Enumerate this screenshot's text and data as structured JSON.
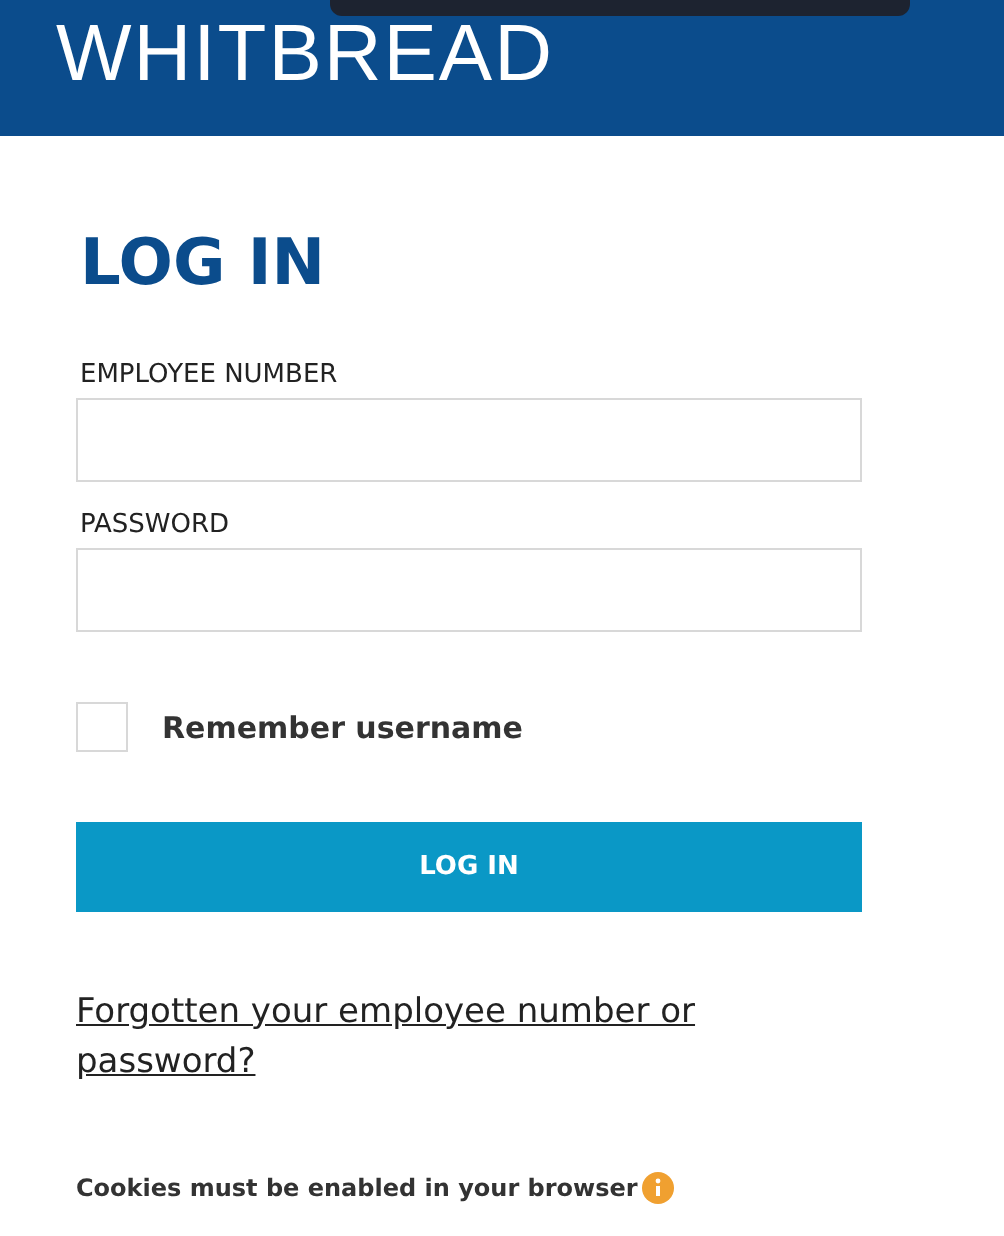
{
  "header": {
    "logo": "WHITBREAD"
  },
  "form": {
    "title": "LOG IN",
    "fields": [
      {
        "label": "EMPLOYEE NUMBER"
      },
      {
        "label": "PASSWORD"
      }
    ],
    "remember": {
      "label": "Remember username",
      "checked": false
    },
    "submit": "LOG IN",
    "forgot_link": "Forgotten your employee number or password?",
    "cookie_note": "Cookies must be enabled in your browser"
  }
}
